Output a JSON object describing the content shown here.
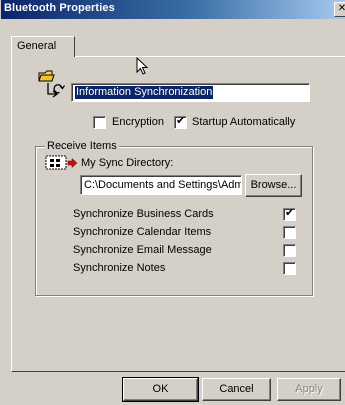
{
  "window": {
    "title": "Bluetooth Properties",
    "close_glyph": "✕"
  },
  "tabs": [
    {
      "label": "General"
    }
  ],
  "general": {
    "service_name_value": "Information Synchronization",
    "encryption": {
      "label": "Encryption",
      "checked": false
    },
    "startup_auto": {
      "label": "Startup Automatically",
      "checked": true
    }
  },
  "receive_items": {
    "title": "Receive Items",
    "directory_label": "My Sync Directory:",
    "directory_value": "C:\\Documents and Settings\\Adm",
    "browse_label": "Browse...",
    "options": [
      {
        "label": "Synchronize Business Cards",
        "checked": true
      },
      {
        "label": "Synchronize Calendar Items",
        "checked": false
      },
      {
        "label": "Synchronize Email Message",
        "checked": false
      },
      {
        "label": "Synchronize Notes",
        "checked": false
      }
    ]
  },
  "buttons": {
    "ok": "OK",
    "cancel": "Cancel",
    "apply": "Apply"
  },
  "colors": {
    "titlebar_start": "#0a246a",
    "titlebar_end": "#a6caf0",
    "dialog_face": "#d4d0c8",
    "selection": "#0a246a"
  },
  "icons": {
    "service": "sync-folder-icon",
    "directory": "directory-transfer-icon",
    "pointer": "mouse-cursor-icon"
  }
}
